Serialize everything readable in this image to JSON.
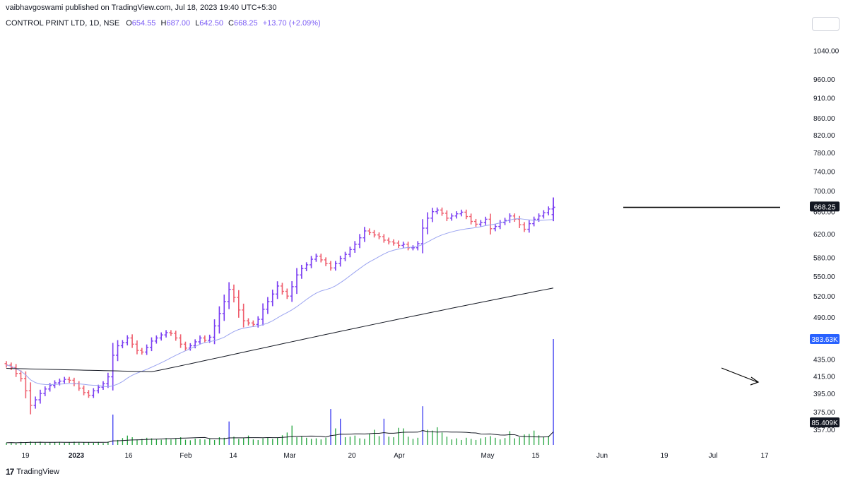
{
  "header": {
    "published_by": "vaibhavgoswami published on TradingView.com, Jul 18, 2023 19:40 UTC+5:30"
  },
  "legend": {
    "symbol": "CONTROL PRINT LTD, 1D, NSE",
    "open_label": "O",
    "open": "654.55",
    "high_label": "H",
    "high": "687.00",
    "low_label": "L",
    "low": "642.50",
    "close_label": "C",
    "close": "668.25",
    "change": "+13.70 (+2.09%)"
  },
  "footer": {
    "brand": "TradingView",
    "logo_icon": "tradingview-logo-icon"
  },
  "colors": {
    "up_bar": "#7b3ff2",
    "down_bar": "#ef5f6e",
    "ma_fast": "#9aa3f0",
    "ma_slow": "#131722",
    "vol_up": "#26a641",
    "vol_spike": "#3b3bf0",
    "price_label_bg": "#131722",
    "vol_label_bg": "#2962ff"
  },
  "chart_data": {
    "type": "ohlc",
    "y_scale": "log",
    "y_ticks": [
      "1040.00",
      "960.00",
      "910.00",
      "860.00",
      "820.00",
      "780.00",
      "740.00",
      "700.00",
      "660.00",
      "620.00",
      "580.00",
      "550.00",
      "520.00",
      "490.00",
      "435.00",
      "415.00",
      "395.00",
      "375.00",
      "357.00"
    ],
    "x_tick_labels": [
      {
        "label": "19",
        "bold": false
      },
      {
        "label": "2023",
        "bold": true
      },
      {
        "label": "16",
        "bold": false
      },
      {
        "label": "Feb",
        "bold": false
      },
      {
        "label": "14",
        "bold": false
      },
      {
        "label": "Mar",
        "bold": false
      },
      {
        "label": "20",
        "bold": false
      },
      {
        "label": "Apr",
        "bold": false
      },
      {
        "label": "May",
        "bold": false
      },
      {
        "label": "15",
        "bold": false
      },
      {
        "label": "Jun",
        "bold": false
      },
      {
        "label": "19",
        "bold": false
      },
      {
        "label": "Jul",
        "bold": false
      },
      {
        "label": "17",
        "bold": false
      }
    ],
    "last_price_label": "668.25",
    "volume_label": "383.63K",
    "volume_ma_label": "85.409K",
    "resistance_level": 668,
    "closes": [
      428,
      425,
      418,
      412,
      398,
      382,
      388,
      395,
      400,
      404,
      407,
      409,
      411,
      410,
      406,
      401,
      396,
      393,
      398,
      402,
      406,
      414,
      440,
      452,
      456,
      462,
      454,
      446,
      444,
      450,
      458,
      462,
      466,
      469,
      468,
      462,
      454,
      449,
      452,
      457,
      462,
      459,
      463,
      478,
      495,
      512,
      530,
      518,
      500,
      485,
      482,
      480,
      487,
      501,
      512,
      523,
      535,
      527,
      520,
      534,
      552,
      562,
      568,
      577,
      582,
      576,
      570,
      563,
      570,
      578,
      585,
      593,
      602,
      613,
      625,
      622,
      618,
      615,
      609,
      606,
      604,
      600,
      602,
      596,
      596,
      603,
      630,
      648,
      660,
      663,
      657,
      648,
      652,
      656,
      659,
      651,
      642,
      637,
      640,
      646,
      629,
      633,
      640,
      644,
      652,
      646,
      636,
      628,
      638,
      646,
      652,
      658,
      665,
      668
    ],
    "volume": [
      8,
      9,
      7,
      11,
      10,
      13,
      9,
      12,
      8,
      10,
      9,
      11,
      8,
      9,
      12,
      10,
      9,
      10,
      8,
      11,
      7,
      12,
      110,
      18,
      25,
      34,
      28,
      20,
      22,
      26,
      24,
      21,
      19,
      25,
      20,
      24,
      28,
      19,
      17,
      23,
      21,
      20,
      24,
      18,
      28,
      26,
      85,
      30,
      22,
      25,
      34,
      20,
      18,
      24,
      28,
      22,
      26,
      35,
      45,
      70,
      28,
      30,
      26,
      22,
      24,
      20,
      26,
      130,
      60,
      95,
      28,
      30,
      34,
      24,
      22,
      40,
      55,
      32,
      95,
      30,
      28,
      62,
      60,
      30,
      22,
      26,
      140,
      55,
      52,
      64,
      45,
      30,
      20,
      24,
      18,
      26,
      22,
      18,
      24,
      28,
      32,
      26,
      20,
      25,
      50,
      24,
      28,
      38,
      40,
      52,
      35,
      30,
      33,
      383
    ]
  }
}
